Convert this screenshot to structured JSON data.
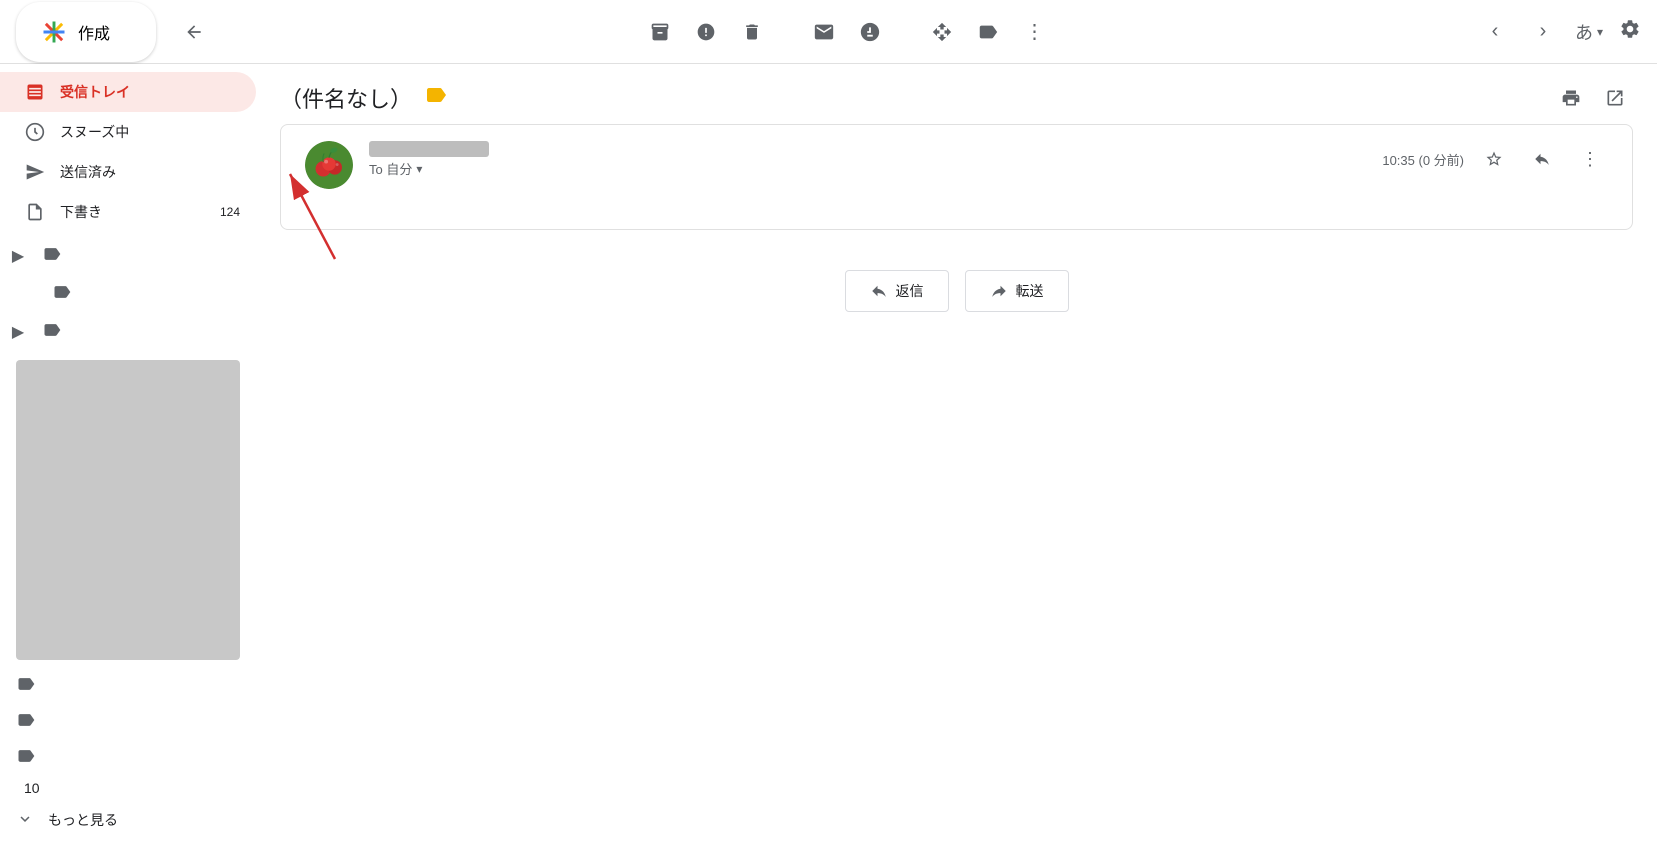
{
  "compose": {
    "label": "作成",
    "plus_symbol": "+"
  },
  "toolbar": {
    "back_label": "←",
    "icons": [
      {
        "name": "archive-icon",
        "symbol": "⬇",
        "label": "アーカイブ"
      },
      {
        "name": "spam-icon",
        "symbol": "⚠",
        "label": "迷惑メール"
      },
      {
        "name": "delete-icon",
        "symbol": "🗑",
        "label": "削除"
      },
      {
        "name": "mail-icon",
        "symbol": "✉",
        "label": "メール"
      },
      {
        "name": "snooze-icon",
        "symbol": "🕐",
        "label": "スヌーズ"
      },
      {
        "name": "forward-icon",
        "symbol": "➡",
        "label": "転送"
      },
      {
        "name": "label-icon",
        "symbol": "🏷",
        "label": "ラベル"
      },
      {
        "name": "more-icon",
        "symbol": "⋮",
        "label": "その他"
      }
    ]
  },
  "nav": {
    "prev_label": "‹",
    "next_label": "›",
    "lang_label": "あ",
    "settings_label": "⚙"
  },
  "sidebar": {
    "items": [
      {
        "id": "inbox",
        "label": "受信トレイ",
        "icon": "📥",
        "active": true,
        "badge": ""
      },
      {
        "id": "snoozed",
        "label": "スヌーズ中",
        "icon": "🕐",
        "active": false,
        "badge": ""
      },
      {
        "id": "sent",
        "label": "送信済み",
        "icon": "➤",
        "active": false,
        "badge": ""
      },
      {
        "id": "drafts",
        "label": "下書き",
        "icon": "📄",
        "active": false,
        "badge": "124"
      }
    ],
    "categories": [
      {
        "icon": "🏷",
        "expandable": true
      },
      {
        "icon": "🏷"
      },
      {
        "icon": "🏷",
        "expandable": true
      },
      {
        "icon": "🏷"
      },
      {
        "icon": "🏷"
      },
      {
        "icon": "🏷"
      }
    ],
    "number": "10",
    "see_more": "もっと見る"
  },
  "email": {
    "subject": "（件名なし）",
    "important_marker": "▶",
    "sender_name": "",
    "to_label": "To 自分",
    "time": "10:35 (0 分前)",
    "reply_btn": "返信",
    "forward_btn": "転送",
    "reply_icon": "↩",
    "forward_icon": "↪"
  },
  "annotation": {
    "arrow_label": "矢印"
  }
}
